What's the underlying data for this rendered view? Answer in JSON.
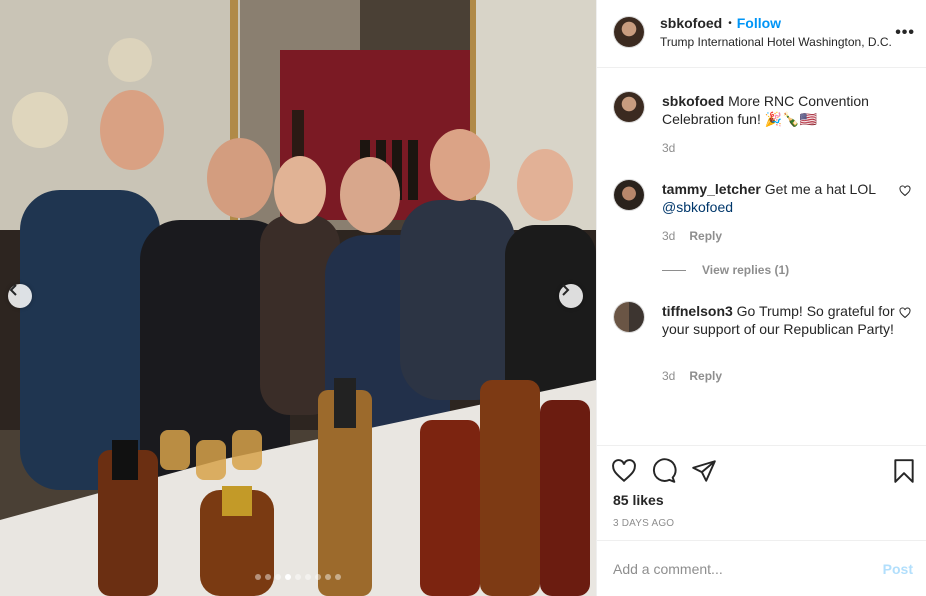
{
  "post": {
    "photo_alt": "Group photo",
    "dots_total": 9,
    "dots_active_index": 3,
    "nav": {
      "prev_icon": "chevron-left-icon",
      "next_icon": "chevron-right-icon"
    }
  },
  "header": {
    "username": "sbkofoed",
    "separator": "•",
    "follow_label": "Follow",
    "location": "Trump International Hotel Washington, D.C.",
    "more_label": "•••"
  },
  "caption": {
    "username": "sbkofoed",
    "text": "More RNC Convention Celebration fun! 🎉🍾🇺🇸",
    "time": "3d"
  },
  "comments": [
    {
      "username": "tammy_letcher",
      "text": "Get me a hat LOL",
      "mention": "@sbkofoed",
      "time": "3d",
      "reply_label": "Reply"
    },
    {
      "username": "tiffnelson3",
      "text": "Go Trump! So grateful for your support of our Republican Party!",
      "time": "3d",
      "reply_label": "Reply"
    }
  ],
  "view_replies_label": "View replies (1)",
  "actions": {
    "likes": "85 likes",
    "date": "3 DAYS AGO"
  },
  "add_comment": {
    "placeholder": "Add a comment...",
    "post_label": "Post"
  },
  "colors": {
    "accent": "#0095f6",
    "post_disabled": "#b2dffc",
    "secondary_text": "#8e8e8e",
    "primary_text": "#262626"
  }
}
